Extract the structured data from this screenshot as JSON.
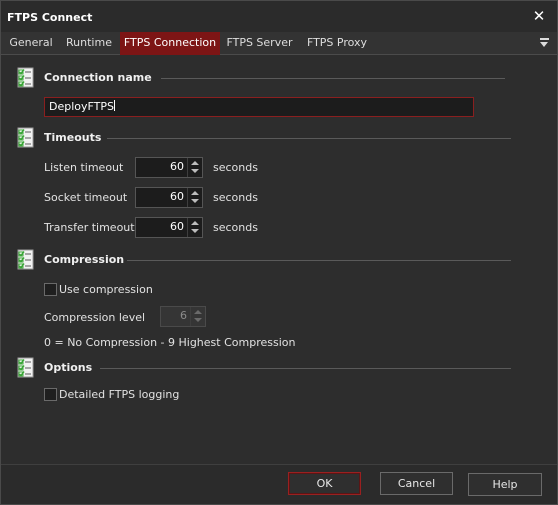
{
  "window": {
    "title": "FTPS Connect"
  },
  "tabs": [
    {
      "label": "General"
    },
    {
      "label": "Runtime"
    },
    {
      "label": "FTPS Connection"
    },
    {
      "label": "FTPS Server"
    },
    {
      "label": "FTPS Proxy"
    }
  ],
  "active_tab": "FTPS Connection",
  "sections": {
    "connection": {
      "title": "Connection name",
      "name_value": "DeployFTPS"
    },
    "timeouts": {
      "title": "Timeouts",
      "listen": {
        "label": "Listen timeout",
        "value": "60",
        "unit": "seconds"
      },
      "socket": {
        "label": "Socket timeout",
        "value": "60",
        "unit": "seconds"
      },
      "transfer": {
        "label": "Transfer timeout",
        "value": "60",
        "unit": "seconds"
      }
    },
    "compression": {
      "title": "Compression",
      "use_label": "Use compression",
      "use_checked": false,
      "level_label": "Compression level",
      "level_value": "6",
      "hint": "0 = No Compression - 9 Highest Compression"
    },
    "options": {
      "title": "Options",
      "logging_label": "Detailed FTPS logging",
      "logging_checked": false
    }
  },
  "buttons": {
    "ok": "OK",
    "cancel": "Cancel",
    "help": "Help"
  },
  "colors": {
    "accent": "#7d1515",
    "background": "#2d2d2d",
    "input_background": "#1c1c1c",
    "icon_green": "#3aa537"
  },
  "icons": {
    "close": "close-icon",
    "tab_menu": "dropdown-menu-icon",
    "section": "checklist-icon"
  }
}
